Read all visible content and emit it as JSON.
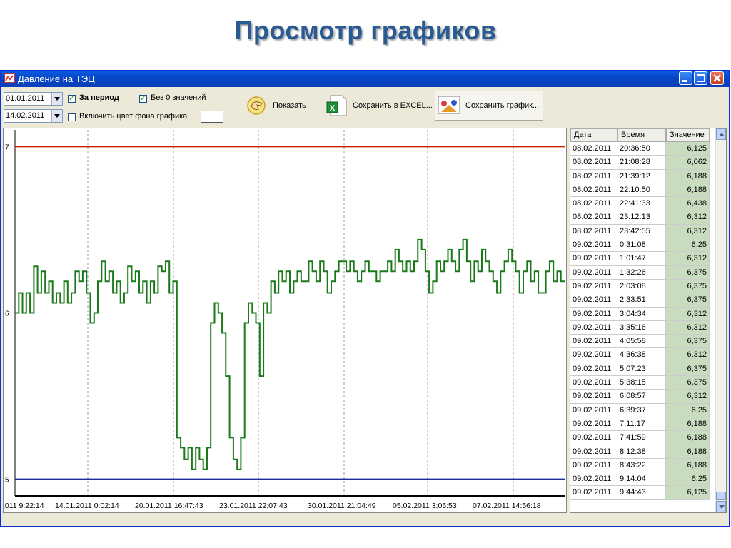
{
  "slide": {
    "title": "Просмотр графиков"
  },
  "window": {
    "title": "Давление  на ТЭЦ"
  },
  "toolbar": {
    "date_from": "01.01.2011",
    "date_to": "14.02.2011",
    "period_checked": true,
    "period_label": "За период",
    "nozero_checked": true,
    "nozero_label": "Без 0 значений",
    "bgcolor_checked": false,
    "bgcolor_label": "Включить цвет фона графика",
    "show_label": "Показать",
    "save_excel_label": "Сохранить в EXCEL...",
    "save_chart_label": "Сохранить график..."
  },
  "colors": {
    "series": "#1a7a1a",
    "upper_limit": "#cc2200",
    "lower_limit": "#1a2aa0",
    "value_cell": "#c8dcc0"
  },
  "chart_data": {
    "type": "line",
    "y_ticks": [
      "7",
      "6",
      "5"
    ],
    "ylim": [
      4.9,
      7.1
    ],
    "upper_limit": 7,
    "lower_limit": 5,
    "x_tick_labels": [
      "2011 9:22:14",
      "14.01.2011 0:02:14",
      "20.01.2011 16:47:43",
      "23.01.2011 22:07:43",
      "30.01.2011 21:04:49",
      "05.02.2011 3:05:53",
      "07.02.2011 14:56:18"
    ],
    "series": [
      {
        "values": [
          6.0,
          6.12,
          6.0,
          6.12,
          6.0,
          6.28,
          6.12,
          6.25,
          6.12,
          6.19,
          6.06,
          6.12,
          6.06,
          6.19,
          6.06,
          6.12,
          6.25,
          6.19,
          6.25,
          6.12,
          5.94,
          6.0,
          6.19,
          6.31,
          6.19,
          6.25,
          6.12,
          6.19,
          6.06,
          6.12,
          6.28,
          6.19,
          6.25,
          6.12,
          6.19,
          6.06,
          6.19,
          6.12,
          6.28,
          6.25,
          6.31,
          6.12,
          6.19,
          5.25,
          5.19,
          5.12,
          5.19,
          5.06,
          5.19,
          5.12,
          5.06,
          5.19,
          5.94,
          6.06,
          6.0,
          5.88,
          5.62,
          5.25,
          5.12,
          5.06,
          5.25,
          5.94,
          6.06,
          6.0,
          5.94,
          5.62,
          6.06,
          6.0,
          6.19,
          6.12,
          6.25,
          6.19,
          6.25,
          6.12,
          6.19,
          6.25,
          6.19,
          6.19,
          6.31,
          6.25,
          6.19,
          6.31,
          6.25,
          6.12,
          6.19,
          6.25,
          6.31,
          6.31,
          6.25,
          6.31,
          6.25,
          6.19,
          6.25,
          6.31,
          6.25,
          6.25,
          6.19,
          6.25,
          6.25,
          6.31,
          6.25,
          6.38,
          6.31,
          6.25,
          6.31,
          6.25,
          6.31,
          6.44,
          6.38,
          6.25,
          6.12,
          6.19,
          6.31,
          6.25,
          6.31,
          6.38,
          6.31,
          6.25,
          6.38,
          6.44,
          6.31,
          6.19,
          6.31,
          6.25,
          6.38,
          6.31,
          6.25,
          6.19,
          6.12,
          6.25,
          6.31,
          6.38,
          6.31,
          6.25,
          6.12,
          6.25,
          6.31,
          6.19,
          6.25,
          6.12,
          6.12,
          6.25,
          6.31,
          6.19,
          6.25,
          6.19
        ]
      }
    ]
  },
  "table": {
    "columns": [
      "Дата",
      "Время",
      "Значение"
    ],
    "rows": [
      [
        "08.02.2011",
        "20:36:50",
        "6,125"
      ],
      [
        "08.02.2011",
        "21:08:28",
        "6,062"
      ],
      [
        "08.02.2011",
        "21:39:12",
        "6,188"
      ],
      [
        "08.02.2011",
        "22:10:50",
        "6,188"
      ],
      [
        "08.02.2011",
        "22:41:33",
        "6,438"
      ],
      [
        "08.02.2011",
        "23:12:13",
        "6,312"
      ],
      [
        "08.02.2011",
        "23:42:55",
        "6,312"
      ],
      [
        "09.02.2011",
        "0:31:08",
        "6,25"
      ],
      [
        "09.02.2011",
        "1:01:47",
        "6,312"
      ],
      [
        "09.02.2011",
        "1:32:26",
        "6,375"
      ],
      [
        "09.02.2011",
        "2:03:08",
        "6,375"
      ],
      [
        "09.02.2011",
        "2:33:51",
        "6,375"
      ],
      [
        "09.02.2011",
        "3:04:34",
        "6,312"
      ],
      [
        "09.02.2011",
        "3:35:16",
        "6,312"
      ],
      [
        "09.02.2011",
        "4:05:58",
        "6,375"
      ],
      [
        "09.02.2011",
        "4:36:38",
        "6,312"
      ],
      [
        "09.02.2011",
        "5:07:23",
        "6,375"
      ],
      [
        "09.02.2011",
        "5:38:15",
        "6,375"
      ],
      [
        "09.02.2011",
        "6:08:57",
        "6,312"
      ],
      [
        "09.02.2011",
        "6:39:37",
        "6,25"
      ],
      [
        "09.02.2011",
        "7:11:17",
        "6,188"
      ],
      [
        "09.02.2011",
        "7:41:59",
        "6,188"
      ],
      [
        "09.02.2011",
        "8:12:38",
        "6,188"
      ],
      [
        "09.02.2011",
        "8:43:22",
        "6,188"
      ],
      [
        "09.02.2011",
        "9:14:04",
        "6,25"
      ],
      [
        "09.02.2011",
        "9:44:43",
        "6,125"
      ]
    ]
  }
}
